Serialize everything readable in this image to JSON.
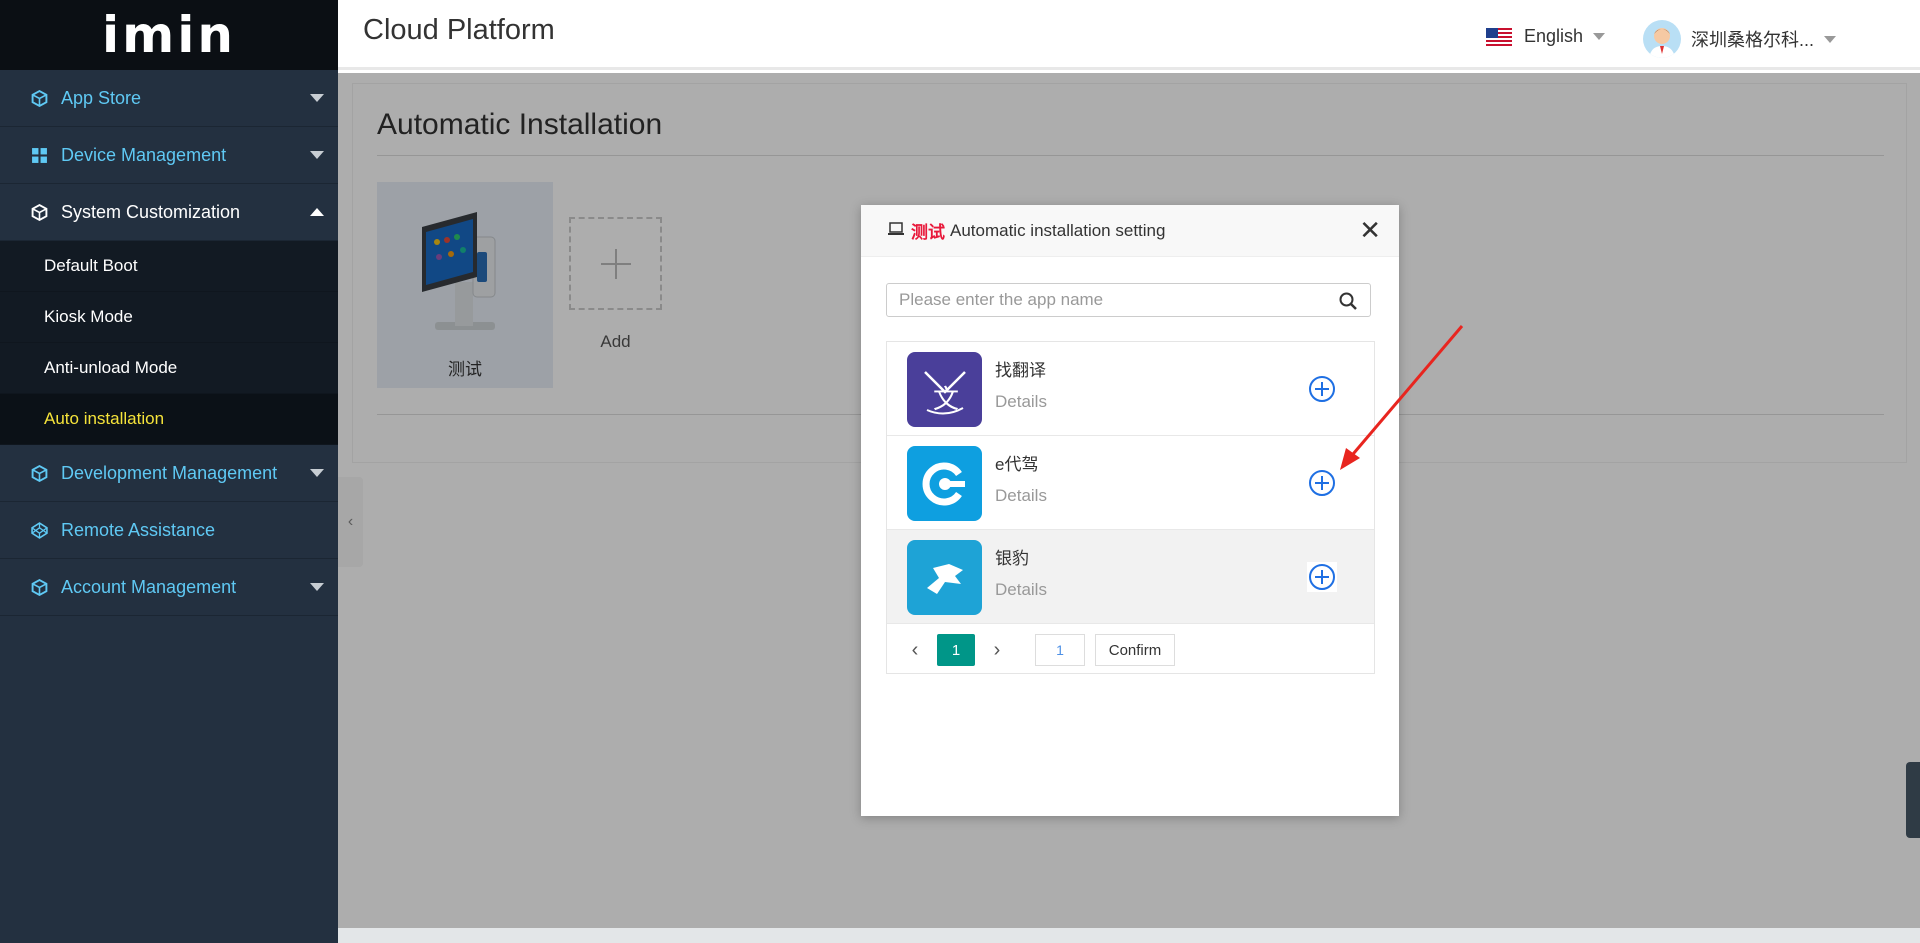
{
  "sidebar": {
    "logo": "imin",
    "menu": [
      {
        "label": "App Store"
      },
      {
        "label": "Device Management"
      },
      {
        "label": "System Customization"
      },
      {
        "label": "Development Management"
      },
      {
        "label": "Remote Assistance"
      },
      {
        "label": "Account Management"
      }
    ],
    "submenu": [
      {
        "label": "Default Boot"
      },
      {
        "label": "Kiosk Mode"
      },
      {
        "label": "Anti-unload Mode"
      },
      {
        "label": "Auto installation"
      }
    ]
  },
  "header": {
    "title": "Cloud Platform",
    "language": "English",
    "user_name": "深圳桑格尔科..."
  },
  "main": {
    "title": "Automatic Installation",
    "device_name": "测试",
    "add_label": "Add"
  },
  "modal": {
    "device": "测试",
    "title": "Automatic installation setting",
    "search_placeholder": "Please enter the app name",
    "apps": [
      {
        "name": "找翻译",
        "details": "Details"
      },
      {
        "name": "e代驾",
        "details": "Details"
      },
      {
        "name": "银豹",
        "details": "Details"
      }
    ],
    "pager": {
      "current_page": "1",
      "goto_value": "1",
      "confirm": "Confirm"
    }
  },
  "colors": {
    "sidebar_bg": "#233040",
    "menu_text": "#5fc9f4",
    "active_sub": "#f5e33a",
    "accent_red": "#e8183a",
    "pager_active": "#009688",
    "add_icon_blue": "#1e6fe3"
  }
}
